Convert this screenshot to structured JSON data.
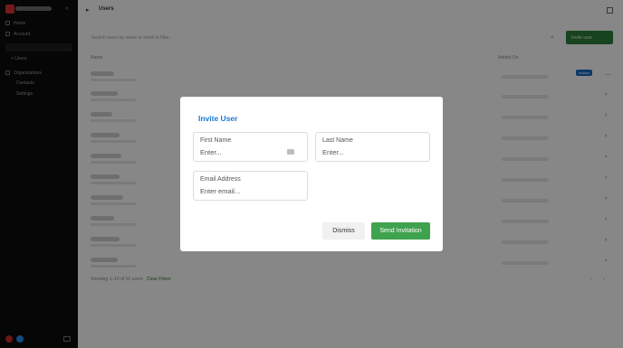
{
  "colors": {
    "sidebar_bg": "#0b0b0b",
    "overlay": "rgba(0,0,0,0.45)",
    "modal_title": "#1a7ad3",
    "send_button": "#3fa24e",
    "logo": "#d32f2f",
    "avatar_red": "#c62828",
    "avatar_blue": "#1e88e5"
  },
  "sidebar": {
    "items": [
      {
        "label": "Home",
        "icon": "home-icon"
      },
      {
        "label": "Account",
        "icon": "account-icon"
      }
    ],
    "new_label": "+ Users",
    "section_label": "Organizations",
    "sub_items": [
      "Contacts",
      "Settings"
    ]
  },
  "header": {
    "title": "Users"
  },
  "toolbar": {
    "search_placeholder": "Search users by name or email to filter...",
    "invite_label": "Invite user"
  },
  "table": {
    "columns": [
      "Name",
      "Added On"
    ],
    "rows": 10,
    "badge": "Invited"
  },
  "footer": {
    "summary": "Showing 1–10 of 10 users",
    "clear_link": "Clear Filters"
  },
  "modal": {
    "title": "Invite User",
    "first_name_label": "First Name",
    "first_name_placeholder": "Enter...",
    "last_name_label": "Last Name",
    "last_name_placeholder": "Enter...",
    "email_label": "Email Address",
    "email_placeholder": "Enter email...",
    "dismiss_label": "Dismiss",
    "send_label": "Send Invitation"
  }
}
